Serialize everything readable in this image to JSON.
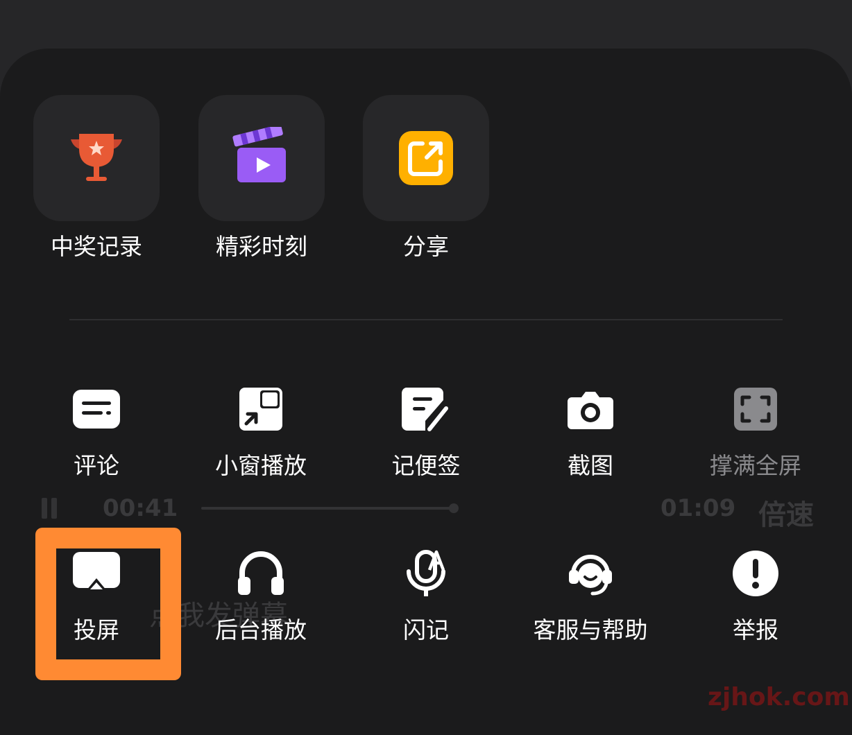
{
  "background_player": {
    "elapsed": "00:41",
    "duration": "01:09",
    "speed_label": "倍速",
    "danmaku_placeholder": "点我发弹幕",
    "progress_fraction": 0.6
  },
  "top_features": [
    {
      "label": "中奖记录",
      "icon": "trophy-icon"
    },
    {
      "label": "精彩时刻",
      "icon": "video-clapper-icon"
    },
    {
      "label": "分享",
      "icon": "share-icon"
    }
  ],
  "actions_row1": [
    {
      "label": "评论",
      "icon": "comment-icon"
    },
    {
      "label": "小窗播放",
      "icon": "mini-window-icon"
    },
    {
      "label": "记便签",
      "icon": "note-icon"
    },
    {
      "label": "截图",
      "icon": "camera-icon"
    },
    {
      "label": "撑满全屏",
      "icon": "fullscreen-icon",
      "disabled": true
    }
  ],
  "actions_row2": [
    {
      "label": "投屏",
      "icon": "cast-icon"
    },
    {
      "label": "后台播放",
      "icon": "headphones-icon"
    },
    {
      "label": "闪记",
      "icon": "voice-note-icon"
    },
    {
      "label": "客服与帮助",
      "icon": "customer-service-icon"
    },
    {
      "label": "举报",
      "icon": "report-icon"
    }
  ],
  "watermark": "zjhok.com",
  "colors": {
    "highlight": "#ff8a33",
    "sheet_bg": "#1b1b1c",
    "tile_bg": "#272729",
    "disabled_text": "#8a8a8d"
  }
}
